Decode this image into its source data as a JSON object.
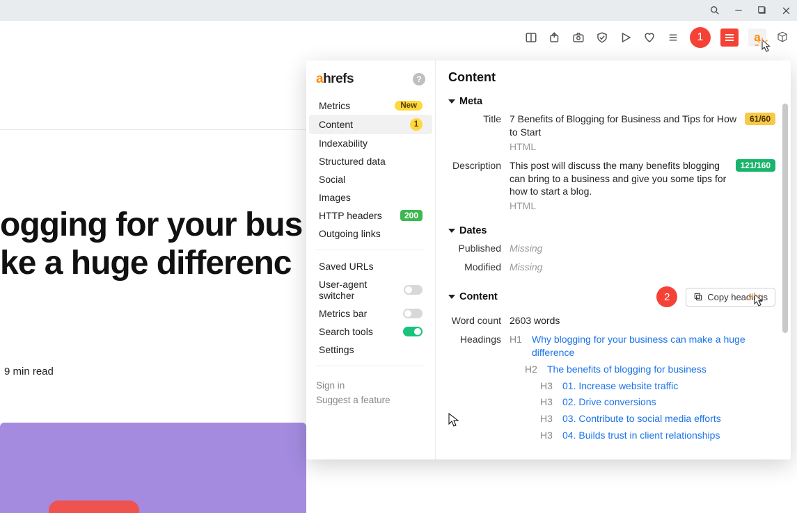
{
  "window": {
    "title": ""
  },
  "page": {
    "hero_line1": "ogging for your bus",
    "hero_line2": "ke a huge differenc",
    "read_time": "9 min read"
  },
  "callouts": {
    "one": "1",
    "two": "2"
  },
  "panel": {
    "logo_a": "a",
    "logo_rest": "hrefs",
    "nav": {
      "metrics": "Metrics",
      "metrics_badge": "New",
      "content": "Content",
      "content_badge": "1",
      "indexability": "Indexability",
      "structured": "Structured data",
      "social": "Social",
      "images": "Images",
      "http": "HTTP headers",
      "http_badge": "200",
      "outgoing": "Outgoing links",
      "saved": "Saved URLs",
      "ua_switch": "User-agent switcher",
      "metrics_bar": "Metrics bar",
      "search_tools": "Search tools",
      "settings": "Settings",
      "signin": "Sign in",
      "suggest": "Suggest a feature"
    },
    "right": {
      "title": "Content",
      "meta_label": "Meta",
      "title_k": "Title",
      "title_v": "7 Benefits of Blogging for Business and Tips for How to Start",
      "title_sub": "HTML",
      "title_badge": "61/60",
      "desc_k": "Description",
      "desc_v": "This post will discuss the many benefits blogging can bring to a business and give you some tips for how to start a blog.",
      "desc_sub": "HTML",
      "desc_badge": "121/160",
      "dates_label": "Dates",
      "published_k": "Published",
      "published_v": "Missing",
      "modified_k": "Modified",
      "modified_v": "Missing",
      "content_label": "Content",
      "copy_btn": "Copy headings",
      "wordcount_k": "Word count",
      "wordcount_v": "2603 words",
      "headings_k": "Headings",
      "headings": [
        {
          "level": "H1",
          "text": "Why blogging for your business can make a huge difference",
          "indent": 1
        },
        {
          "level": "H2",
          "text": "The benefits of blogging for business",
          "indent": 2
        },
        {
          "level": "H3",
          "text": "01. Increase website traffic",
          "indent": 3
        },
        {
          "level": "H3",
          "text": "02. Drive conversions",
          "indent": 3
        },
        {
          "level": "H3",
          "text": "03. Contribute to social media efforts",
          "indent": 3
        },
        {
          "level": "H3",
          "text": "04. Builds trust in client relationships",
          "indent": 3
        }
      ]
    }
  }
}
